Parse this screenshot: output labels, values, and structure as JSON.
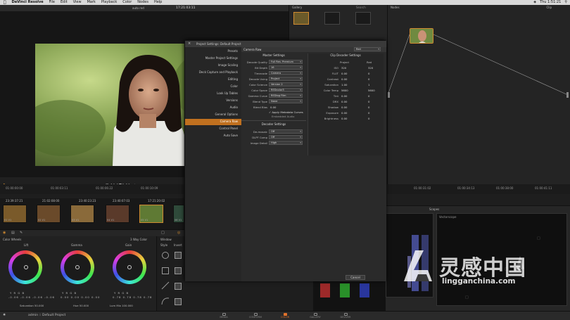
{
  "menubar": {
    "app_name": "DaVinci Resolve",
    "items": [
      "File",
      "Edit",
      "View",
      "Mark",
      "Playback",
      "Color",
      "Nodes",
      "Help"
    ],
    "clock": "Thu 1:51:21"
  },
  "viewer": {
    "clip_name": "auto red",
    "timecode": "17:21:03:11"
  },
  "gallery": {
    "title": "Gallery",
    "search_placeholder": "Search"
  },
  "nodes": {
    "title": "Nodes",
    "clip_label": "Clip",
    "node_number": "01"
  },
  "timeline": {
    "ruler_left": [
      "01:00:00:00",
      "01:00:03:11",
      "01:00:06:22",
      "01:00:10:09"
    ],
    "ruler_right": [
      "01:00:31:02",
      "01:00:34:13",
      "01:00:38:00",
      "01:00:41:11"
    ],
    "clips": [
      {
        "tc": "23:39:37:21",
        "label": "01 V1"
      },
      {
        "tc": "21:02:08:00",
        "label": "02 V1"
      },
      {
        "tc": "23:40:23:23",
        "label": "03 V1"
      },
      {
        "tc": "23:40:07:03",
        "label": "04 V1"
      },
      {
        "tc": "17:21:20:02",
        "label": "05 V1"
      },
      {
        "tc": "",
        "label": "06 V1"
      }
    ]
  },
  "color_wheels": {
    "title": "Color Wheels",
    "mode": "3 Way Color",
    "lift_label": "Lift",
    "gamma_label": "Gamma",
    "gain_label": "Gain",
    "lift_values": "-0.06  -0.06  -0.06  -0.06",
    "gamma_values": "0.00  0.00  0.00  0.00",
    "gain_values": "0.78  0.78  0.78  0.78",
    "saturation": "Saturation  50.000",
    "hue": "Hue  50.000",
    "lum_mix": "Lum Mix  100.000",
    "channel_letters": "Y  R  G  B"
  },
  "window_panel": {
    "title": "Window",
    "style_label": "Style",
    "invert_label": "Invert"
  },
  "scopes": {
    "title": "Scopes",
    "vectorscope_label": "Vectorscope"
  },
  "status": {
    "project": "admin :: Default Project",
    "pages": [
      "MEDIA",
      "CONFORM",
      "COLOR",
      "GALLERY",
      "DELIVER"
    ],
    "active_page": "COLOR"
  },
  "dialog": {
    "title": "Project Settings: Default Project",
    "nav": [
      "Presets",
      "Master Project Settings",
      "Image Scaling",
      "Deck Capture and Playback",
      "Editing",
      "Color",
      "Look Up Tables",
      "Versions",
      "Audio",
      "General Options",
      "Camera Raw",
      "Control Panel",
      "Auto Save"
    ],
    "active_nav": "Camera Raw",
    "raw_format": "Camera Raw",
    "raw_profile": "Red",
    "master_settings_head": "Master Settings",
    "master": [
      {
        "label": "Decode Quality",
        "value": "Full Res. Premium"
      },
      {
        "label": "Bit Depth",
        "value": "16"
      },
      {
        "label": "Timecode",
        "value": "Camera"
      },
      {
        "label": "Decode Using",
        "value": "Project"
      },
      {
        "label": "Color Science",
        "value": "Version 2"
      },
      {
        "label": "Color Space",
        "value": "REDcolor3"
      },
      {
        "label": "Gamma Curve",
        "value": "REDlog Film"
      },
      {
        "label": "Blend Type",
        "value": "None"
      }
    ],
    "blend_bias_label": "Blend Bias",
    "blend_bias_value": "0.00",
    "apply_metadata": "Apply Metadata Curves",
    "embedded_audio": "Embedded Audio",
    "decoder_head": "Decoder Settings",
    "decoder": [
      {
        "label": "De-mosaic",
        "value": "Off"
      },
      {
        "label": "DLPF Comp",
        "value": "Off"
      },
      {
        "label": "Image Detail",
        "value": "High"
      }
    ],
    "clip_decoder_head": "Clip Decoder Settings",
    "col_project": "Project",
    "col_red": "Red",
    "clip_rows": [
      {
        "label": "ISO",
        "project": "320",
        "red": "320"
      },
      {
        "label": "FLUT",
        "project": "0.00",
        "red": "0"
      },
      {
        "label": "Contrast",
        "project": "0.00",
        "red": "0"
      },
      {
        "label": "Saturation",
        "project": "1.00",
        "red": "1"
      },
      {
        "label": "Color Temp",
        "project": "5600",
        "red": "5600"
      },
      {
        "label": "Tint",
        "project": "0.00",
        "red": "0"
      },
      {
        "label": "DRX",
        "project": "0.00",
        "red": "0"
      },
      {
        "label": "Shadow",
        "project": "0.00",
        "red": "0"
      },
      {
        "label": "Exposure",
        "project": "0.00",
        "red": "0"
      },
      {
        "label": "Brightness",
        "project": "0.00",
        "red": "0"
      }
    ],
    "cancel_label": "Cancel"
  },
  "watermark": {
    "cn": "灵感中国",
    "en": "lingganchina.com"
  },
  "colors": {
    "accent": "#e2722b",
    "nav_active": "#c0701f",
    "panel": "#2c2c2c"
  }
}
